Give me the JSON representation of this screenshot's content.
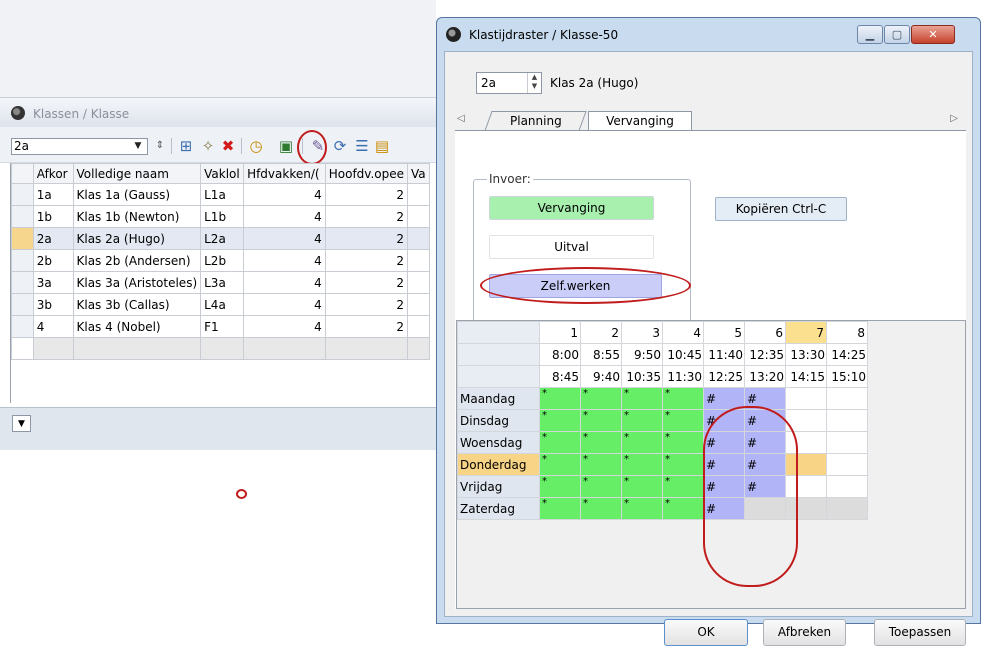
{
  "left_window": {
    "title": "Klassen / Klasse",
    "combo_value": "2a",
    "columns": [
      "Afkor",
      "Volledige naam",
      "Vaklol",
      "Hfdvakken/(",
      "Hoofdv.opee",
      "Va"
    ],
    "rows": [
      {
        "afk": "1a",
        "naam": "Klas 1a (Gauss)",
        "vak": "L1a",
        "hfd": "4",
        "hoofdv": "2"
      },
      {
        "afk": "1b",
        "naam": "Klas 1b (Newton)",
        "vak": "L1b",
        "hfd": "4",
        "hoofdv": "2"
      },
      {
        "afk": "2a",
        "naam": "Klas 2a (Hugo)",
        "vak": "L2a",
        "hfd": "4",
        "hoofdv": "2"
      },
      {
        "afk": "2b",
        "naam": "Klas 2b (Andersen)",
        "vak": "L2b",
        "hfd": "4",
        "hoofdv": "2"
      },
      {
        "afk": "3a",
        "naam": "Klas 3a (Aristoteles)",
        "vak": "L3a",
        "hfd": "4",
        "hoofdv": "2"
      },
      {
        "afk": "3b",
        "naam": "Klas 3b (Callas)",
        "vak": "L4a",
        "hfd": "4",
        "hoofdv": "2"
      },
      {
        "afk": "4",
        "naam": "Klas 4 (Nobel)",
        "vak": "F1",
        "hfd": "4",
        "hoofdv": "2"
      }
    ]
  },
  "dialog": {
    "title": "Klastijdraster / Klasse-50",
    "klas_value": "2a",
    "klas_name": "Klas 2a (Hugo)",
    "tabs": [
      "Planning",
      "Vervanging"
    ],
    "invoer_label": "Invoer:",
    "buttons": {
      "vervanging": "Vervanging",
      "uitval": "Uitval",
      "zelf": "Zelf.werken",
      "kopieren": "Kopiëren Ctrl-C",
      "ok": "OK",
      "afbreken": "Afbreken",
      "toepassen": "Toepassen"
    },
    "periods": [
      "1",
      "2",
      "3",
      "4",
      "5",
      "6",
      "7",
      "8"
    ],
    "start_times": [
      "8:00",
      "8:55",
      "9:50",
      "10:45",
      "11:40",
      "12:35",
      "13:30",
      "14:25"
    ],
    "end_times": [
      "8:45",
      "9:40",
      "10:35",
      "11:30",
      "12:25",
      "13:20",
      "14:15",
      "15:10"
    ],
    "days": [
      "Maandag",
      "Dinsdag",
      "Woensdag",
      "Donderdag",
      "Vrijdag",
      "Zaterdag"
    ],
    "lesson_mark": "*",
    "replacement_mark": "#"
  },
  "colors": {
    "vervanging": "#a7f0ae",
    "zelfwerken": "#c9cdf7",
    "lesson_green": "#66ee66",
    "replacement_blue": "#b1b4f6",
    "current_day": "#f8d486",
    "annotation_red": "#c01c1c"
  }
}
